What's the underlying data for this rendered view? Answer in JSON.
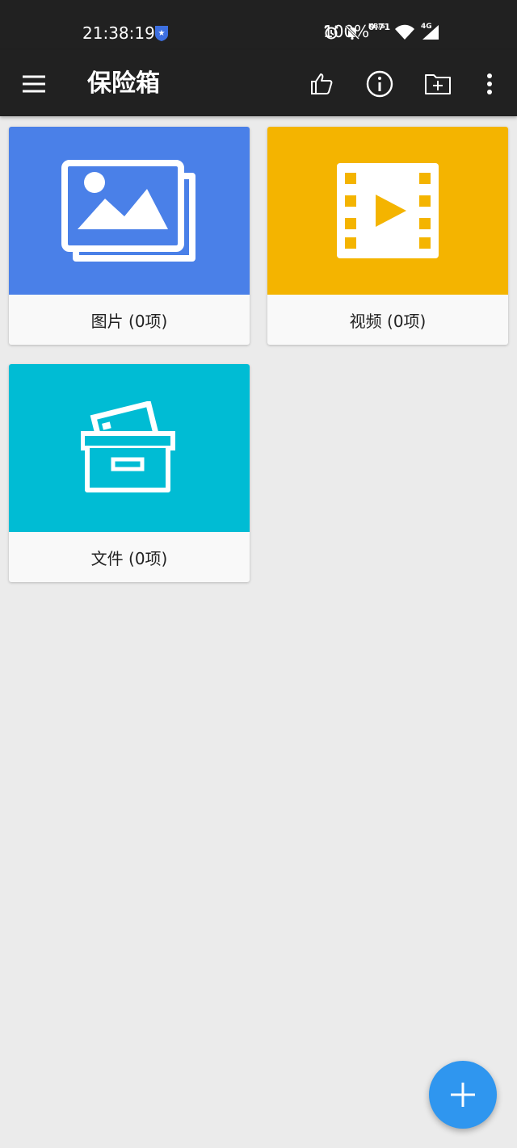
{
  "status_bar": {
    "time": "21:38:19",
    "net_speed_value": "0.71",
    "net_speed_unit": "KB/S",
    "network_type": "4G",
    "battery": "100%",
    "icons": [
      "shield-icon",
      "alarm-icon",
      "mute-bell-icon",
      "wifi-icon",
      "signal-icon"
    ]
  },
  "app_bar": {
    "title": "保险箱",
    "icons": [
      "menu-icon",
      "thumbs-up-icon",
      "info-icon",
      "new-folder-icon",
      "more-vert-icon"
    ]
  },
  "categories": [
    {
      "label": "图片 (0项)",
      "color": "#4a80e8",
      "icon": "image-gallery-icon"
    },
    {
      "label": "视频 (0项)",
      "color": "#f4b400",
      "icon": "video-film-icon"
    },
    {
      "label": "文件 (0项)",
      "color": "#00bcd4",
      "icon": "archive-box-icon"
    }
  ],
  "fab": {
    "icon": "plus-icon",
    "color": "#2f96ef"
  }
}
